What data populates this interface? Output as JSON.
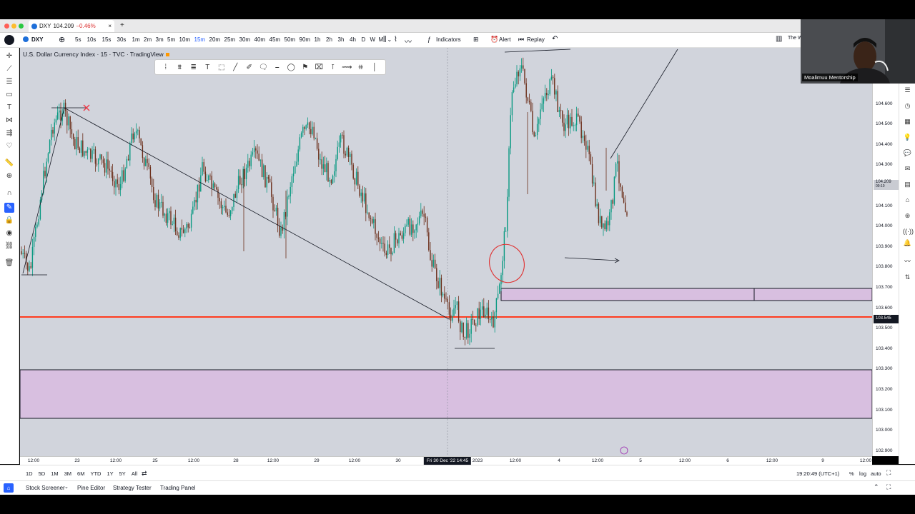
{
  "browser_tab": {
    "symbol": "DXY",
    "price": "104.209",
    "change": "−0.46%",
    "close_glyph": "×",
    "new_tab_glyph": "+"
  },
  "topbar": {
    "symbol": "DXY",
    "timeframes": [
      "5s",
      "10s",
      "15s",
      "30s",
      "1m",
      "2m",
      "3m",
      "5m",
      "10m",
      "15m",
      "20m",
      "25m",
      "30m",
      "40m",
      "45m",
      "50m",
      "90m",
      "1h",
      "2h",
      "3h",
      "4h",
      "D",
      "W",
      "M"
    ],
    "active_timeframe": "15m",
    "indicators_label": "Indicators",
    "alert_label": "Alert",
    "replay_label": "Replay",
    "right_truncated": "The W"
  },
  "chart": {
    "title": "U.S. Dollar Currency Index · 15 · TVC · TradingView",
    "colors": {
      "background": "#d1d4dc",
      "zone_fill": "#d8bfe0",
      "resistance_line": "#ff3b1f",
      "bull": "#089981",
      "bear": "#6b2e1a",
      "trendline": "#131722"
    }
  },
  "price_axis": {
    "ticks": [
      "104.600",
      "104.500",
      "104.400",
      "104.300",
      "104.100",
      "104.000",
      "103.900",
      "103.800",
      "103.700",
      "103.600",
      "103.500",
      "103.400",
      "103.300",
      "103.200",
      "103.100",
      "103.000",
      "102.900"
    ],
    "current_price": "104.209",
    "countdown": "09:10",
    "line_price": "103.545"
  },
  "time_axis": {
    "ticks": [
      "12:00",
      "23",
      "12:00",
      "25",
      "12:00",
      "28",
      "12:00",
      "29",
      "12:00",
      "30",
      "2023",
      "12:00",
      "4",
      "12:00",
      "5",
      "12:00",
      "6",
      "12:00",
      "9",
      "12:00"
    ],
    "crosshair_label": "Fri 30 Dec '22   14:45"
  },
  "bottombar": {
    "ranges": [
      "1D",
      "5D",
      "1M",
      "3M",
      "6M",
      "YTD",
      "1Y",
      "5Y",
      "All"
    ],
    "clock": "19:20:49 (UTC+1)",
    "percent_label": "%",
    "log_label": "log",
    "auto_label": "auto"
  },
  "panels": [
    "Stock Screener",
    "Pine Editor",
    "Strategy Tester",
    "Trading Panel"
  ],
  "webcam": {
    "caption": "Moalimuu Mentorship"
  }
}
